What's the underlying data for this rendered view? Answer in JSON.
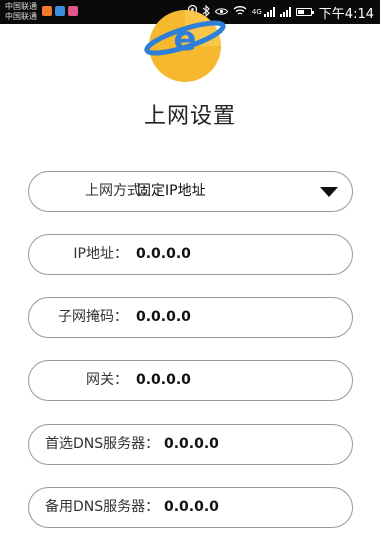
{
  "status_bar": {
    "carrier_1": "中国联通",
    "carrier_2": "中国联通",
    "network_type": "4G",
    "time": "下午4:14",
    "battery_level": 0.5
  },
  "header": {
    "title": "上网设置",
    "logo_letter": "e"
  },
  "form": {
    "connection_type": {
      "label": "上网方式：",
      "value": "固定IP地址"
    },
    "ip": {
      "label": "IP地址：",
      "value": "0.0.0.0"
    },
    "subnet_mask": {
      "label": "子网掩码：",
      "value": "0.0.0.0"
    },
    "gateway": {
      "label": "网关：",
      "value": "0.0.0.0"
    },
    "primary_dns": {
      "label": "首选DNS服务器：",
      "value": "0.0.0.0"
    },
    "secondary_dns": {
      "label": "备用DNS服务器：",
      "value": "0.0.0.0"
    }
  },
  "colors": {
    "status_bar": "#0a0a0a",
    "logo_gold": "#f5b82e",
    "logo_blue": "#2e7fd8",
    "field_border": "#999999"
  },
  "icons": [
    "location-icon",
    "bluetooth-icon",
    "eye-icon",
    "wifi-icon",
    "signal-icon",
    "battery-icon",
    "dropdown-caret-icon"
  ]
}
